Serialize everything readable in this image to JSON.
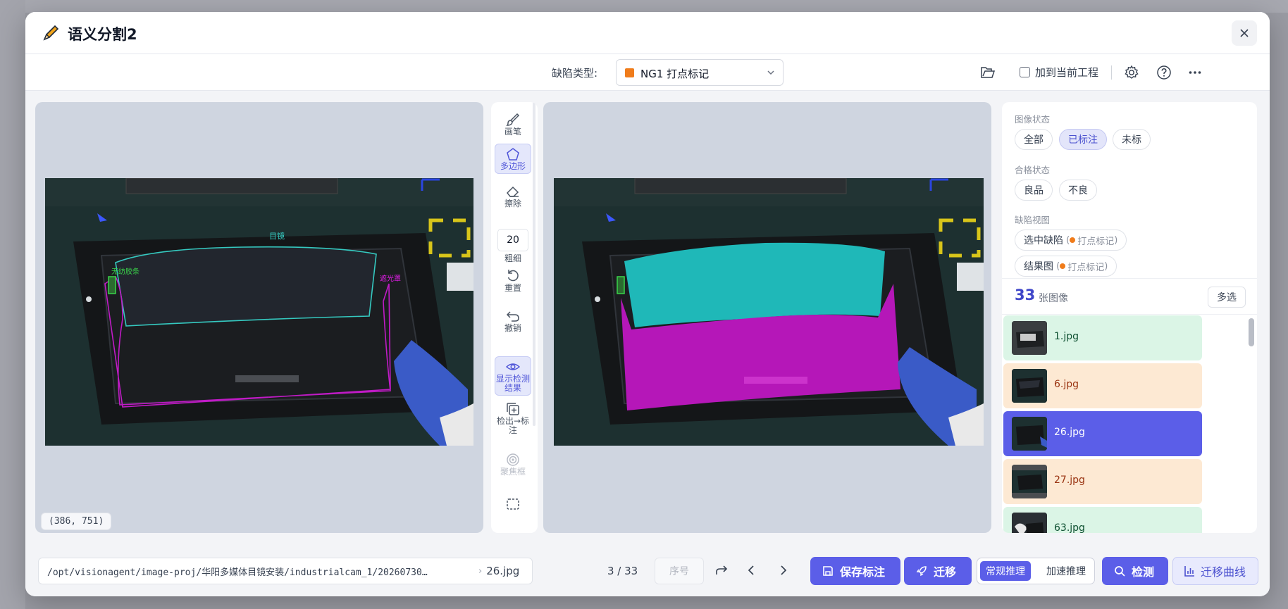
{
  "modal": {
    "title": "语义分割2",
    "close_icon": "close-icon"
  },
  "toolbar": {
    "defect_type_label": "缺陷类型:",
    "defect_type_value": "NG1 打点标记",
    "defect_color": "#f07c1b",
    "add_to_project_label": "加到当前工程",
    "add_to_project_checked": false
  },
  "tools": {
    "brush": "画笔",
    "polygon": "多边形",
    "erase": "擦除",
    "thickness_value": "20",
    "thickness_label": "粗细",
    "reset": "重置",
    "undo": "撤销",
    "show_results": "显示检测结果",
    "detect_to_label": "检出→标注",
    "cluster": "聚焦框"
  },
  "viewer": {
    "coordinates": "(386, 751)",
    "annotation_labels": {
      "target": "目镜",
      "left": "无纺胶条",
      "right": "遮光罩"
    }
  },
  "side": {
    "image_status_title": "图像状态",
    "image_status_options": [
      "全部",
      "已标注",
      "未标"
    ],
    "image_status_selected": "已标注",
    "quality_title": "合格状态",
    "quality_options": [
      "良品",
      "不良"
    ],
    "defect_view_title": "缺陷视图",
    "defect_view_options": [
      {
        "label": "选中缺陷",
        "tag": "打点标记"
      },
      {
        "label": "结果图",
        "tag": "打点标记"
      }
    ],
    "image_count": "33",
    "image_count_label": "张图像",
    "multi_select_label": "多选",
    "files": [
      {
        "name": "1.jpg",
        "status": "green"
      },
      {
        "name": "6.jpg",
        "status": "orange"
      },
      {
        "name": "26.jpg",
        "status": "selected"
      },
      {
        "name": "27.jpg",
        "status": "orange"
      },
      {
        "name": "63.jpg",
        "status": "green"
      }
    ]
  },
  "bottom": {
    "path": "/opt/visionagent/image-proj/华阳多媒体目镜安装/industrialcam_1/20260730…",
    "current_file": "26.jpg",
    "page_indicator": "3 / 33",
    "seq_placeholder": "序号",
    "save_label": "保存标注",
    "migrate_label": "迁移",
    "infer_normal": "常规推理",
    "infer_fast": "加速推理",
    "detect_label": "检测",
    "migrate_curve_label": "迁移曲线"
  }
}
